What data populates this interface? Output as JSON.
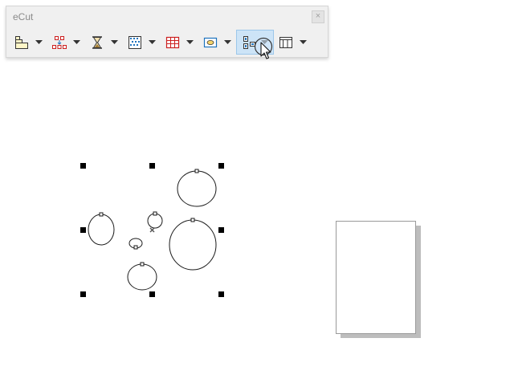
{
  "window": {
    "title": "eCut",
    "close_label": "×"
  },
  "toolbar": {
    "tools": [
      {
        "name": "layout-tool",
        "icon": "stacked-boxes-icon"
      },
      {
        "name": "array-tool",
        "icon": "red-array-icon"
      },
      {
        "name": "hourglass-tool",
        "icon": "hourglass-icon"
      },
      {
        "name": "pattern-tool",
        "icon": "dotted-grid-icon"
      },
      {
        "name": "table-tool",
        "icon": "red-grid-icon"
      },
      {
        "name": "ellipse-frame-tool",
        "icon": "ellipse-in-frame-icon"
      },
      {
        "name": "align-tool",
        "icon": "align-objects-icon",
        "active": true
      },
      {
        "name": "panel-tool",
        "icon": "panel-layout-icon"
      }
    ]
  },
  "colors": {
    "accent": "#1e73be",
    "red_icon": "#cc1f1f",
    "active_tool_bg": "#cde4f7",
    "page_shadow": "#bdbdbd"
  }
}
